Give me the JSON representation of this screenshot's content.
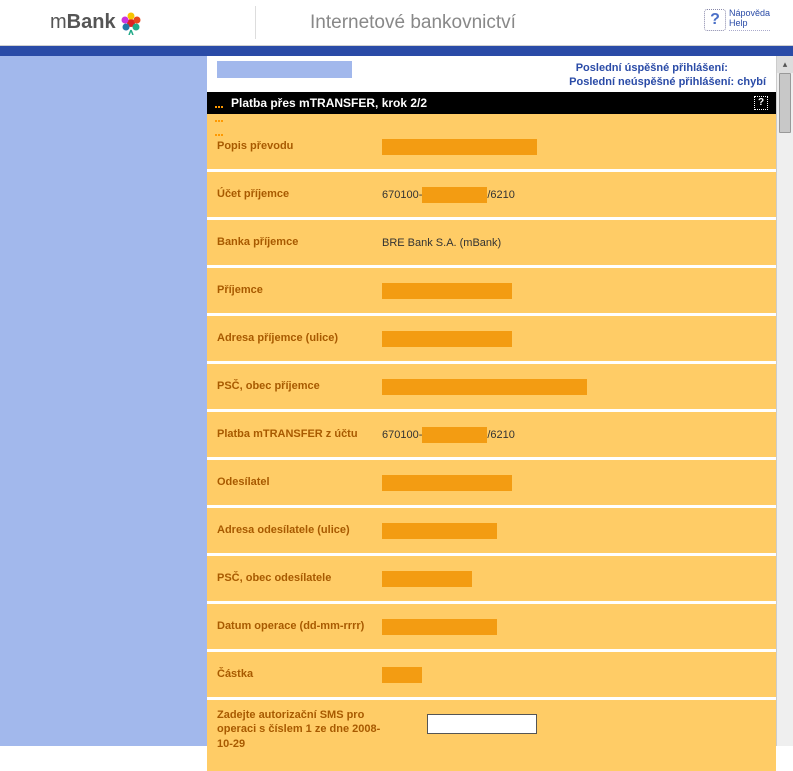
{
  "header": {
    "logo_m": "m",
    "logo_bank": "Bank",
    "title": "Internetové bankovnictví",
    "help_line1": "Nápověda",
    "help_line2": "Help"
  },
  "login_info": {
    "success_label": "Poslední úspěšné přihlášení:",
    "failure_label": "Poslední neúspěšné přihlášení:",
    "failure_value": "chybí"
  },
  "section_title": "Platba přes mTRANSFER, krok 2/2",
  "rows": {
    "desc_label": "Popis převodu",
    "recipient_acct_label": "Účet příjemce",
    "recipient_acct_prefix": "670100-",
    "recipient_acct_suffix": "/6210",
    "recipient_bank_label": "Banka příjemce",
    "recipient_bank_value": "BRE Bank S.A. (mBank)",
    "recipient_name_label": "Příjemce",
    "recipient_street_label": "Adresa příjemce (ulice)",
    "recipient_city_label": "PSČ, obec příjemce",
    "from_acct_label": "Platba mTRANSFER z účtu",
    "from_acct_prefix": "670100-",
    "from_acct_suffix": "/6210",
    "sender_label": "Odesílatel",
    "sender_street_label": "Adresa odesílatele (ulice)",
    "sender_city_label": "PSČ, obec odesílatele",
    "date_label": "Datum operace (dd-mm-rrrr)",
    "amount_label": "Částka",
    "sms_label": "Zadejte autorizační SMS pro operaci s číslem 1 ze dne 2008-10-29"
  }
}
